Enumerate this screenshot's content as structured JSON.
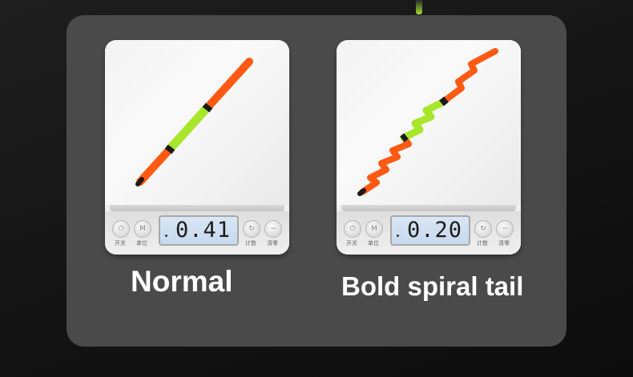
{
  "panel": {
    "scales": [
      {
        "name": "normal",
        "display": "0.41",
        "caption": "Normal",
        "buttons": {
          "left": [
            {
              "glyph": "⏻",
              "label": "开关"
            },
            {
              "glyph": "M",
              "label": "单位"
            }
          ],
          "right": [
            {
              "glyph": "↻",
              "label": "计数"
            },
            {
              "glyph": "−",
              "label": "清零"
            }
          ]
        }
      },
      {
        "name": "bold-spiral-tail",
        "display": "0.20",
        "caption": "Bold spiral tail",
        "buttons": {
          "left": [
            {
              "glyph": "⏻",
              "label": "开关"
            },
            {
              "glyph": "M",
              "label": "单位"
            }
          ],
          "right": [
            {
              "glyph": "↻",
              "label": "计数"
            },
            {
              "glyph": "−",
              "label": "清零"
            }
          ]
        }
      }
    ]
  },
  "colors": {
    "background": "#141414",
    "panel": "#4a4a4a",
    "float_orange": "#ff5a14",
    "float_green": "#a7e62b",
    "lcd_backlight": "#cfdff0"
  },
  "icons": [
    "power-icon",
    "unit-icon",
    "count-icon",
    "tare-icon"
  ]
}
